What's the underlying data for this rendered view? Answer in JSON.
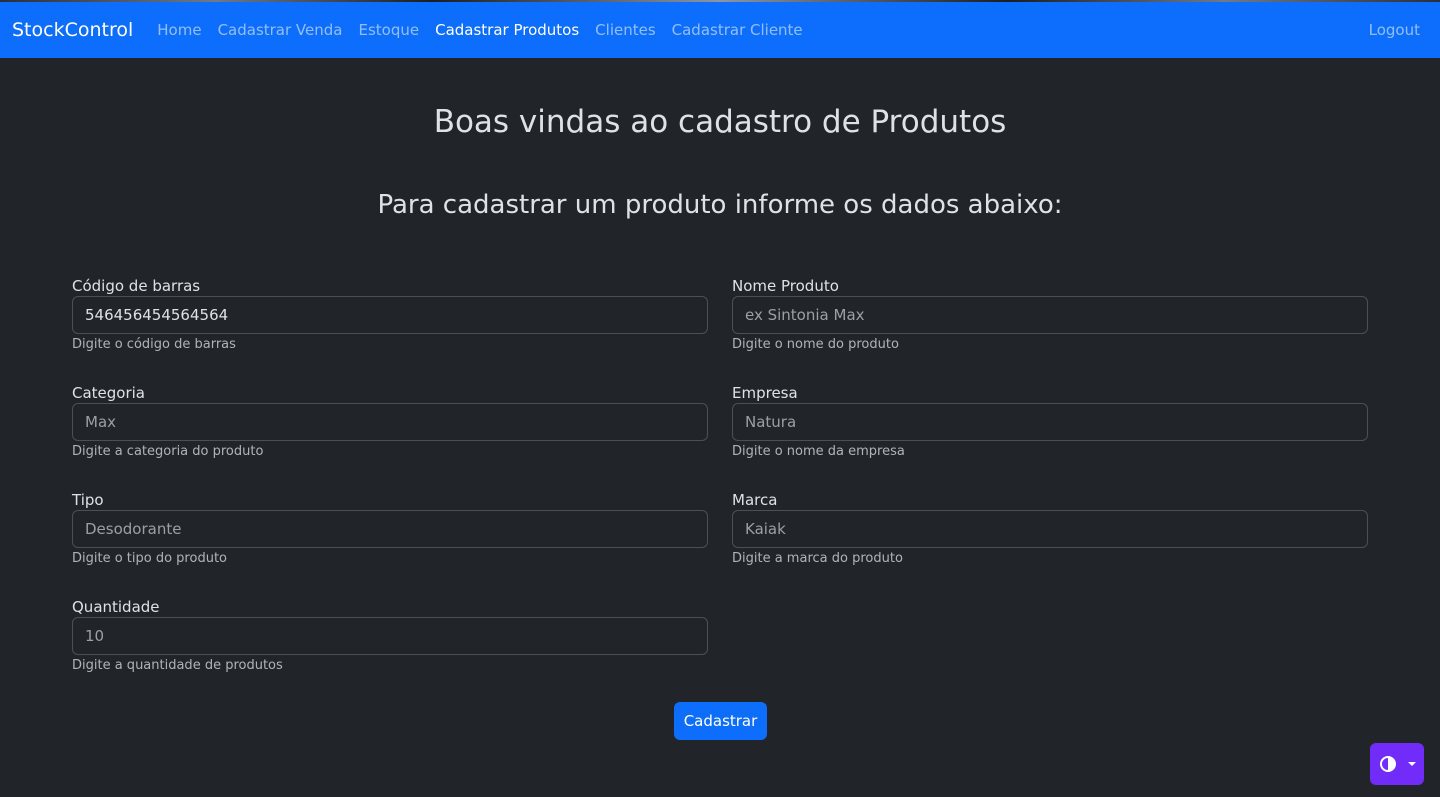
{
  "navbar": {
    "brand": "StockControl",
    "links": [
      {
        "label": "Home"
      },
      {
        "label": "Cadastrar Venda"
      },
      {
        "label": "Estoque"
      },
      {
        "label": "Cadastrar Produtos",
        "active": true
      },
      {
        "label": "Clientes"
      },
      {
        "label": "Cadastrar Cliente"
      }
    ],
    "logout": "Logout",
    "color": "#0d6efd"
  },
  "page": {
    "title": "Boas vindas ao cadastro de Produtos",
    "subtitle": "Para cadastrar um produto informe os dados abaixo:"
  },
  "form": {
    "codigo": {
      "label": "Código de barras",
      "value": "546456454564564",
      "help": "Digite o código de barras"
    },
    "nome": {
      "label": "Nome Produto",
      "placeholder": "ex Sintonia Max",
      "help": "Digite o nome do produto"
    },
    "categoria": {
      "label": "Categoria",
      "placeholder": "Max",
      "help": "Digite a categoria do produto"
    },
    "empresa": {
      "label": "Empresa",
      "placeholder": "Natura",
      "help": "Digite o nome da empresa"
    },
    "tipo": {
      "label": "Tipo",
      "placeholder": "Desodorante",
      "help": "Digite o tipo do produto"
    },
    "marca": {
      "label": "Marca",
      "placeholder": "Kaiak",
      "help": "Digite a marca do produto"
    },
    "quantidade": {
      "label": "Quantidade",
      "placeholder": "10",
      "help": "Digite a quantidade de produtos"
    },
    "submit_label": "Cadastrar"
  },
  "theme_toggle": {
    "icon": "circle-half-icon",
    "color": "#712cf9"
  }
}
